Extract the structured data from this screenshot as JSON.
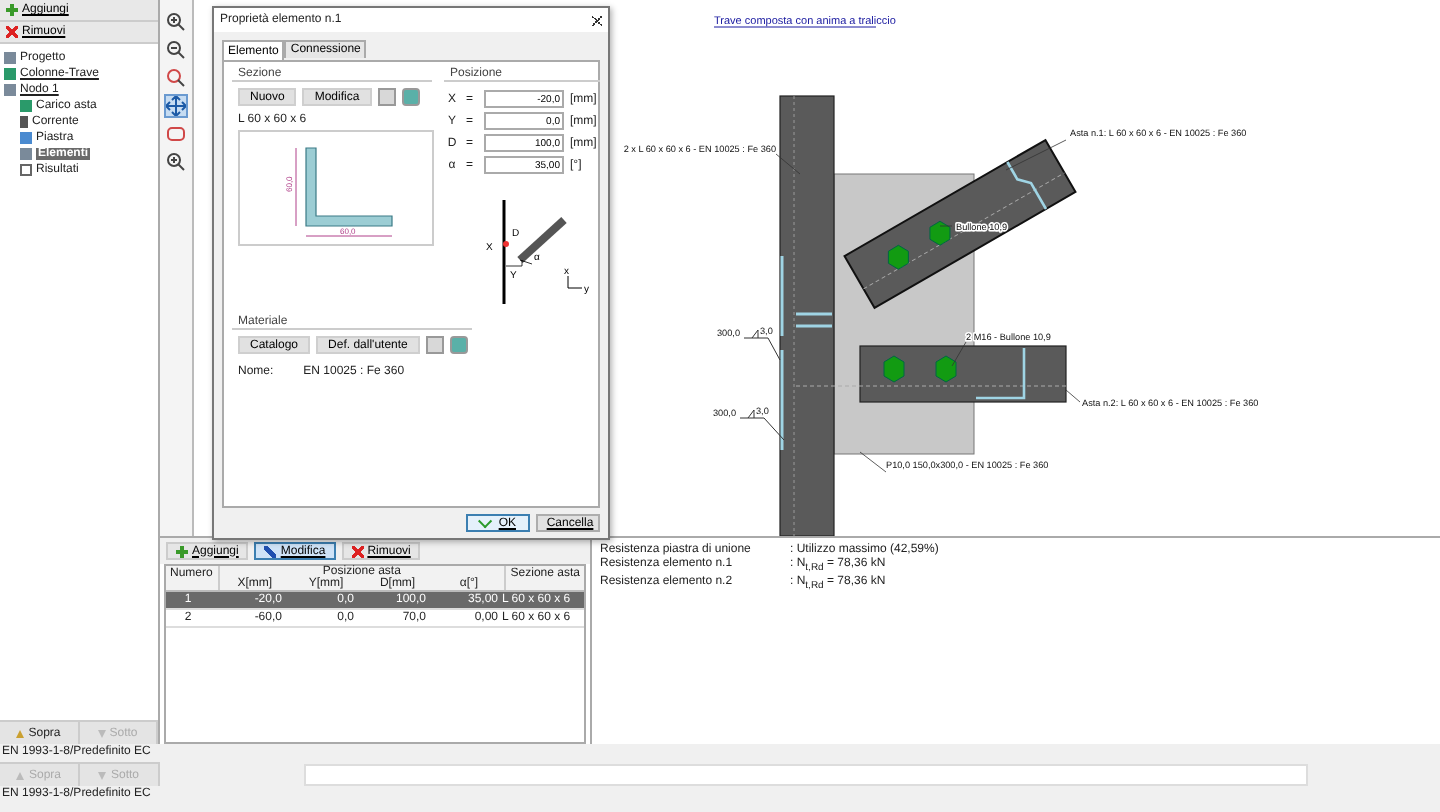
{
  "sidebar": {
    "buttons": [
      {
        "label": "Aggiungi",
        "kind": "add"
      },
      {
        "label": "Rimuovi",
        "kind": "remove"
      }
    ],
    "tree": [
      {
        "label": "Progetto",
        "kind": "project",
        "selected": false
      },
      {
        "label": "Colonne-Trave",
        "kind": "type",
        "selected": false
      },
      {
        "label": "Nodo 1",
        "kind": "node",
        "selected": false,
        "children": [
          {
            "label": "Carico asta",
            "kind": "load",
            "selected": false
          },
          {
            "label": "Corrente",
            "kind": "chord",
            "selected": false
          },
          {
            "label": "Piastra",
            "kind": "plate",
            "selected": false
          },
          {
            "label": "Elementi",
            "kind": "members",
            "selected": true
          },
          {
            "label": "Risultati",
            "kind": "results",
            "selected": false
          }
        ]
      }
    ],
    "move_buttons": [
      {
        "label": "Sopra",
        "kind": "up",
        "disabled": false
      },
      {
        "label": "Sotto",
        "kind": "down",
        "disabled": true
      }
    ]
  },
  "view_tools": [
    {
      "kind": "zoom-in",
      "selected": false
    },
    {
      "kind": "zoom-out",
      "selected": false
    },
    {
      "kind": "zoom-area",
      "selected": false
    },
    {
      "kind": "pan",
      "selected": true
    },
    {
      "kind": "fit",
      "selected": false
    },
    {
      "kind": "zoom",
      "selected": false
    }
  ],
  "canvas": {
    "title": "Trave composta con anima a traliccio",
    "labels": [
      {
        "kind": "chord",
        "text": "2 x L 60 x 60 x 6 - EN 10025 : Fe 360"
      },
      {
        "kind": "member1",
        "text": "Asta n.1: L 60 x 60 x 6 - EN 10025 : Fe 360"
      },
      {
        "kind": "bolt1",
        "text": "Bullone 10,9"
      },
      {
        "kind": "bolt2",
        "text": "2 M16 - Bullone 10,9"
      },
      {
        "kind": "member2",
        "text": "Asta n.2: L 60 x 60 x 6 - EN 10025 : Fe 360"
      },
      {
        "kind": "plate",
        "text": "P10,0 150,0x300,0 - EN 10025 : Fe 360"
      }
    ],
    "welds": [
      {
        "length": "300,0",
        "size": "3,0"
      },
      {
        "length": "300,0",
        "size": "3,0"
      }
    ]
  },
  "dialog": {
    "title": "Proprietà elemento n.1",
    "tabs": [
      {
        "label": "Elemento",
        "selected": true
      },
      {
        "label": "Connessione",
        "selected": false
      }
    ],
    "section": {
      "title": "Sezione",
      "buttons": [
        "Nuovo",
        "Modifica"
      ],
      "name": "L 60 x 60 x 6",
      "dims": [
        "60,0",
        "60,0"
      ]
    },
    "position": {
      "title": "Posizione",
      "fields": [
        {
          "symbol": "X",
          "relation": "=",
          "value": "-20,0",
          "unit": "[mm]"
        },
        {
          "symbol": "Y",
          "relation": "=",
          "value": "0,0",
          "unit": "[mm]"
        },
        {
          "symbol": "D",
          "relation": "=",
          "value": "100,0",
          "unit": "[mm]"
        },
        {
          "symbol": "α",
          "relation": "=",
          "value": "35,00",
          "unit": "[°]"
        }
      ],
      "diagram_labels": [
        "X",
        "D",
        "α",
        "Y"
      ],
      "axis_labels": [
        "x",
        "y"
      ]
    },
    "material": {
      "title": "Materiale",
      "buttons": [
        "Catalogo",
        "Def. dall'utente"
      ],
      "name_label": "Nome:",
      "name": "EN 10025 : Fe 360"
    },
    "buttons": [
      {
        "label": "OK",
        "kind": "ok"
      },
      {
        "label": "Cancella",
        "kind": "cancel"
      }
    ]
  },
  "table_panel": {
    "buttons": [
      {
        "label": "Aggiungi",
        "kind": "add",
        "selected": false
      },
      {
        "label": "Modifica",
        "kind": "edit",
        "selected": true
      },
      {
        "label": "Rimuovi",
        "kind": "remove",
        "selected": false
      }
    ],
    "group_header": "Posizione asta",
    "columns": [
      "Numero",
      "X[mm]",
      "Y[mm]",
      "D[mm]",
      "α[°]",
      "Sezione asta"
    ],
    "rows": [
      {
        "cells": [
          "1",
          "-20,0",
          "0,0",
          "100,0",
          "35,00",
          "L 60 x 60 x 6"
        ],
        "selected": true
      },
      {
        "cells": [
          "2",
          "-60,0",
          "0,0",
          "70,0",
          "0,00",
          "L 60 x 60 x 6"
        ],
        "selected": false
      }
    ]
  },
  "results": [
    {
      "label": "Resistenza piastra di unione",
      "value": ": Utilizzo massimo (42,59%)"
    },
    {
      "label": "Resistenza elemento n.1",
      "value": ": N$_{t,Rd}$ = 78,36 kN"
    },
    {
      "label": "Resistenza elemento n.2",
      "value": ": N$_{t,Rd}$ = 78,36 kN"
    }
  ],
  "status_lines": [
    "EN 1993-1-8/Predefinito EC",
    "EN 1993-1-8/Predefinito EC"
  ],
  "footer_move_buttons": [
    {
      "label": "Sopra",
      "kind": "up",
      "disabled": true
    },
    {
      "label": "Sotto",
      "kind": "down",
      "disabled": true
    }
  ]
}
